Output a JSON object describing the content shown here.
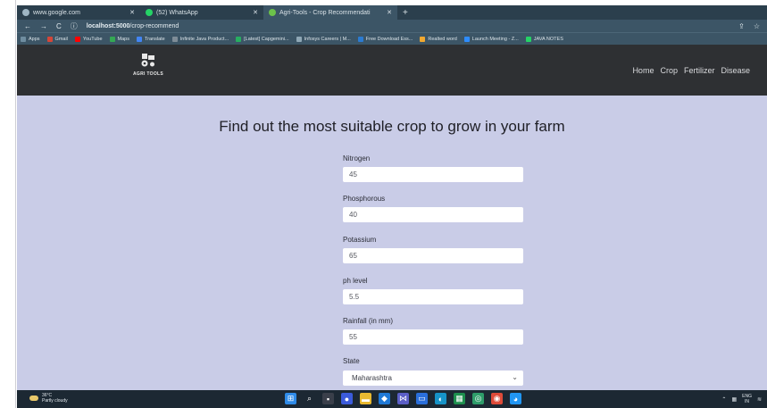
{
  "browser": {
    "tabs": [
      {
        "label": "www.google.com",
        "color": "#9fb6c4"
      },
      {
        "label": "(52) WhatsApp",
        "color": "#25d366"
      },
      {
        "label": "Agri-Tools - Crop Recommendati",
        "color": "#6cc24a"
      }
    ],
    "new_tab": "+",
    "url_host": "localhost:5000",
    "url_path": "/crop-recommend",
    "bookmarks": [
      {
        "label": "Apps",
        "color": "#6f8da0"
      },
      {
        "label": "Gmail",
        "color": "#d44638"
      },
      {
        "label": "YouTube",
        "color": "#ff0000"
      },
      {
        "label": "Maps",
        "color": "#34a853"
      },
      {
        "label": "Translate",
        "color": "#4285f4"
      },
      {
        "label": "Infinite Java Product...",
        "color": "#7e8c97"
      },
      {
        "label": "[Latest] Capgemini...",
        "color": "#27ae60"
      },
      {
        "label": "Infosys Careers | M...",
        "color": "#8fa7b5"
      },
      {
        "label": "Free Download Ess...",
        "color": "#2b7bd1"
      },
      {
        "label": "Realted word",
        "color": "#f0a830"
      },
      {
        "label": "Launch Meeting - Z...",
        "color": "#2d8cff"
      },
      {
        "label": "JAVA NOTES",
        "color": "#25d366"
      }
    ]
  },
  "site": {
    "logo_text": "AGRI TOOLS",
    "nav": [
      "Home",
      "Crop",
      "Fertilizer",
      "Disease"
    ]
  },
  "form": {
    "heading": "Find out the most suitable crop to grow in your farm",
    "fields": [
      {
        "label": "Nitrogen",
        "value": "45"
      },
      {
        "label": "Phosphorous",
        "value": "40"
      },
      {
        "label": "Potassium",
        "value": "65"
      },
      {
        "label": "ph level",
        "value": "5.5"
      },
      {
        "label": "Rainfall (in mm)",
        "value": "55"
      }
    ],
    "state_label": "State",
    "state_value": "Maharashtra"
  },
  "taskbar": {
    "temperature": "36°C",
    "weather": "Partly cloudy",
    "lang_top": "ENG",
    "lang_bottom": "IN"
  }
}
